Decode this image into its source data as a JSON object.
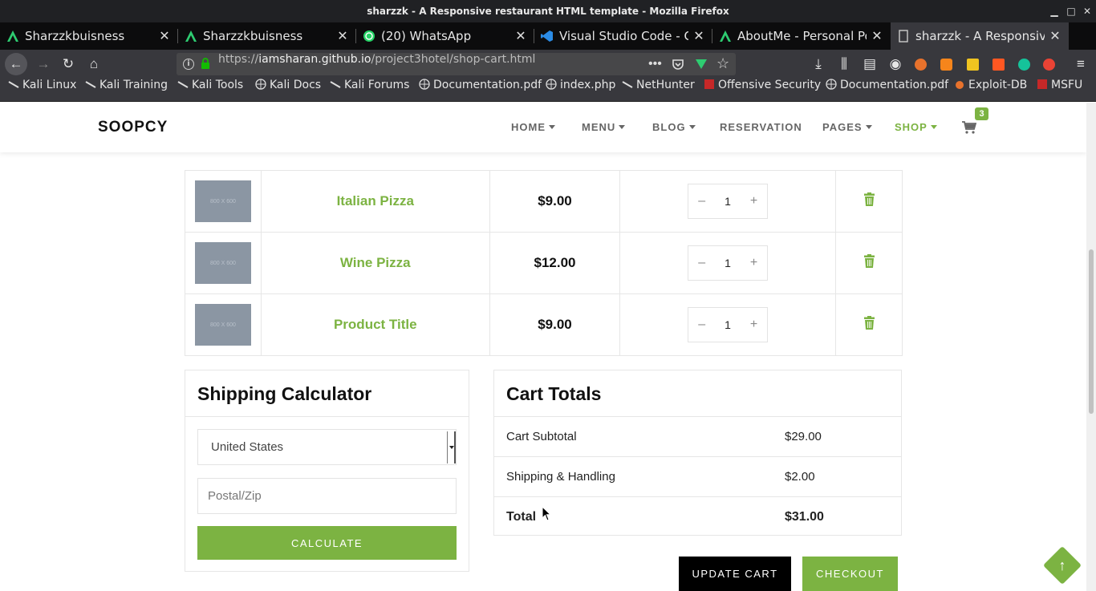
{
  "window": {
    "title": "sharzzk - A Responsive restaurant HTML template - Mozilla Firefox"
  },
  "tabs": [
    {
      "label": "Sharzzkbuisness",
      "icon": "angular-icon"
    },
    {
      "label": "Sharzzkbuisness",
      "icon": "angular-icon"
    },
    {
      "label": "(20) WhatsApp",
      "icon": "whatsapp-icon"
    },
    {
      "label": "Visual Studio Code - Cod",
      "icon": "vscode-icon"
    },
    {
      "label": "AboutMe - Personal Port",
      "icon": "angular-icon"
    },
    {
      "label": "sharzzk - A Responsive r",
      "icon": "page-icon"
    }
  ],
  "navbar": {
    "url_prefix": "https://",
    "url_host": "iamsharan.github.io",
    "url_path": "/project3hotel/shop-cart.html"
  },
  "bookmarks": [
    {
      "label": "Kali Linux",
      "icon": "kali-icon"
    },
    {
      "label": "Kali Training",
      "icon": "kali-icon"
    },
    {
      "label": "Kali Tools",
      "icon": "kali-icon"
    },
    {
      "label": "Kali Docs",
      "icon": "globe-icon"
    },
    {
      "label": "Kali Forums",
      "icon": "kali-icon"
    },
    {
      "label": "Documentation.pdf",
      "icon": "globe-icon"
    },
    {
      "label": "index.php",
      "icon": "globe-icon"
    },
    {
      "label": "NetHunter",
      "icon": "kali-icon"
    },
    {
      "label": "Offensive Security",
      "icon": "offsec-icon"
    },
    {
      "label": "Documentation.pdf",
      "icon": "globe-icon"
    },
    {
      "label": "Exploit-DB",
      "icon": "exploitdb-icon"
    },
    {
      "label": "MSFU",
      "icon": "offsec-icon"
    }
  ],
  "site": {
    "logo": "SOOPCY",
    "menu": [
      {
        "label": "HOME",
        "dropdown": true
      },
      {
        "label": "MENU",
        "dropdown": true
      },
      {
        "label": "BLOG",
        "dropdown": true
      },
      {
        "label": "RESERVATION",
        "dropdown": false
      },
      {
        "label": "PAGES",
        "dropdown": true
      },
      {
        "label": "SHOP",
        "dropdown": true,
        "active": true
      }
    ],
    "cart_count": "3",
    "accent_color": "#7cb342"
  },
  "cart": {
    "items": [
      {
        "thumb": "800 X 600",
        "name": "Italian Pizza",
        "price": "$9.00",
        "qty": "1"
      },
      {
        "thumb": "800 X 600",
        "name": "Wine Pizza",
        "price": "$12.00",
        "qty": "1"
      },
      {
        "thumb": "800 X 600",
        "name": "Product Title",
        "price": "$9.00",
        "qty": "1"
      }
    ],
    "minus": "–",
    "plus": "+"
  },
  "shipping": {
    "title": "Shipping Calculator",
    "country": "United States",
    "zip_placeholder": "Postal/Zip",
    "calculate_label": "CALCULATE"
  },
  "totals": {
    "title": "Cart Totals",
    "subtotal_label": "Cart Subtotal",
    "subtotal_value": "$29.00",
    "shipping_label": "Shipping & Handling",
    "shipping_value": "$2.00",
    "total_label": "Total",
    "total_value": "$31.00"
  },
  "actions": {
    "update_label": "UPDATE CART",
    "checkout_label": "CHECKOUT"
  }
}
